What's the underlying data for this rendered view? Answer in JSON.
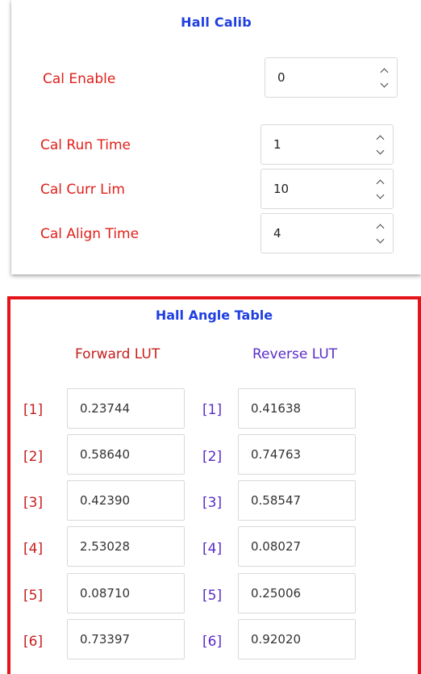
{
  "hall_calib": {
    "title": "Hall Calib",
    "fields": [
      {
        "label": "Cal Enable",
        "value": "0"
      },
      {
        "label": "Cal Run Time",
        "value": "1"
      },
      {
        "label": "Cal Curr Lim",
        "value": "10"
      },
      {
        "label": "Cal Align Time",
        "value": "4"
      }
    ]
  },
  "hall_angle_table": {
    "title": "Hall Angle Table",
    "forward_header": "Forward LUT",
    "reverse_header": "Reverse LUT",
    "rows": [
      {
        "index": "[1]",
        "forward": "0.23744",
        "reverse": "0.41638"
      },
      {
        "index": "[2]",
        "forward": "0.58640",
        "reverse": "0.74763"
      },
      {
        "index": "[3]",
        "forward": "0.42390",
        "reverse": "0.58547"
      },
      {
        "index": "[4]",
        "forward": "2.53028",
        "reverse": "0.08027"
      },
      {
        "index": "[5]",
        "forward": "0.08710",
        "reverse": "0.25006"
      },
      {
        "index": "[6]",
        "forward": "0.73397",
        "reverse": "0.92020"
      }
    ]
  },
  "colors": {
    "title_blue": "#1f3fe0",
    "label_red": "#e0201a",
    "forward_red": "#c71d1d",
    "reverse_purple": "#5a2cc9",
    "table_border": "#e3151a"
  }
}
